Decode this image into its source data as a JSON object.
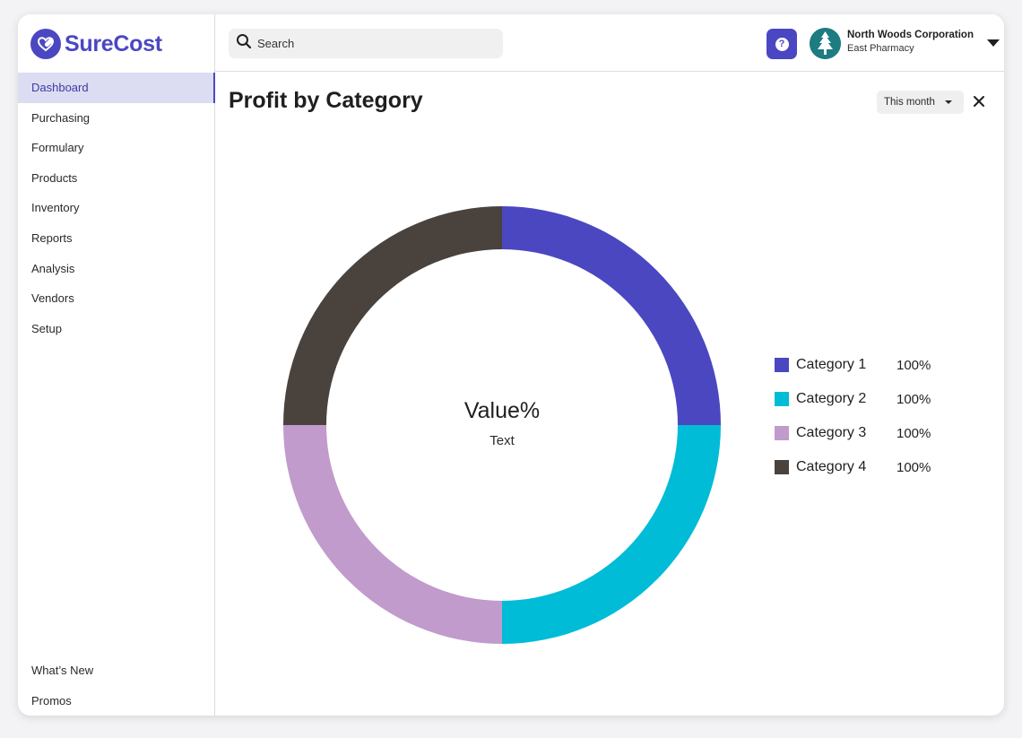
{
  "brand": {
    "name": "SureCost",
    "color": "#4b47c2"
  },
  "sidebar": {
    "items": [
      {
        "label": "Dashboard",
        "active": true
      },
      {
        "label": "Purchasing"
      },
      {
        "label": "Formulary"
      },
      {
        "label": "Products"
      },
      {
        "label": "Inventory"
      },
      {
        "label": "Reports"
      },
      {
        "label": "Analysis"
      },
      {
        "label": "Vendors"
      },
      {
        "label": "Setup"
      }
    ],
    "bottom_items": [
      {
        "label": "What’s New"
      },
      {
        "label": "Promos"
      }
    ]
  },
  "header": {
    "search": {
      "placeholder": "Search",
      "icon": "search-icon"
    },
    "help_icon": "question-icon",
    "org": {
      "name": "North Woods Corporation",
      "location": "East Pharmacy",
      "avatar_icon": "tree-icon"
    }
  },
  "main": {
    "title": "Profit by Category",
    "range_select": {
      "value": "This month"
    },
    "close_icon": "close-icon"
  },
  "chart_data": {
    "type": "pie",
    "center_value": "Value%",
    "center_label": "Text",
    "series": [
      {
        "name": "Category 1",
        "value": 25,
        "label": "100%",
        "color": "#4a47c1"
      },
      {
        "name": "Category 2",
        "value": 25,
        "label": "100%",
        "color": "#00bcd6"
      },
      {
        "name": "Category 3",
        "value": 25,
        "label": "100%",
        "color": "#c09bcb"
      },
      {
        "name": "Category 4",
        "value": 25,
        "label": "100%",
        "color": "#4a423d"
      }
    ],
    "legend_position": "right"
  }
}
